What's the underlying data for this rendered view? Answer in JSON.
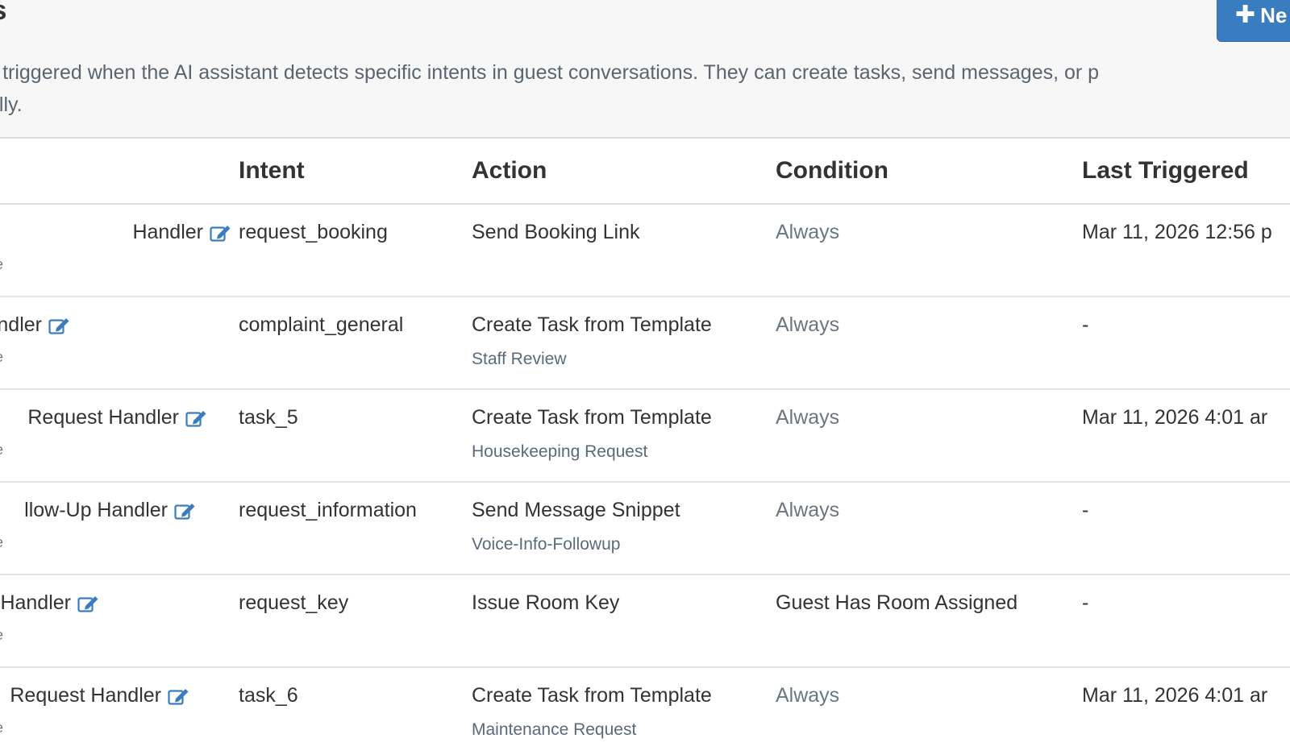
{
  "header": {
    "title": "ons",
    "new_button_label": "Ne",
    "description_line1": "are triggered when the AI assistant detects specific intents in guest conversations. They can create tasks, send messages, or p",
    "description_line2": "tically."
  },
  "table": {
    "columns": [
      "",
      "Intent",
      "Action",
      "Condition",
      "Last Triggered"
    ],
    "rows": [
      {
        "name": "Handler",
        "name_sub": "e",
        "intent": "request_booking",
        "action": "Send Booking Link",
        "action_sub": "",
        "condition": "Always",
        "last_triggered": "Mar 11, 2026 12:56 p"
      },
      {
        "name": "ndler",
        "name_sub": "e",
        "intent": "complaint_general",
        "action": "Create Task from Template",
        "action_sub": "Staff Review",
        "condition": "Always",
        "last_triggered": "-"
      },
      {
        "name": "Request Handler",
        "name_sub": "e",
        "intent": "task_5",
        "action": "Create Task from Template",
        "action_sub": "Housekeeping Request",
        "condition": "Always",
        "last_triggered": "Mar 11, 2026 4:01 ar"
      },
      {
        "name": "llow-Up Handler",
        "name_sub": "e",
        "intent": "request_information",
        "action": "Send Message Snippet",
        "action_sub": "Voice-Info-Followup",
        "condition": "Always",
        "last_triggered": "-"
      },
      {
        "name": "Handler",
        "name_sub": "e",
        "intent": "request_key",
        "action": "Issue Room Key",
        "action_sub": "",
        "condition": "Guest Has Room Assigned",
        "last_triggered": "-"
      },
      {
        "name": "Request Handler",
        "name_sub": "e",
        "intent": "task_6",
        "action": "Create Task from Template",
        "action_sub": "Maintenance Request",
        "condition": "Always",
        "last_triggered": "Mar 11, 2026 4:01 ar"
      }
    ]
  },
  "icons": {
    "edit": "edit-icon",
    "plus": "plus-icon"
  },
  "colors": {
    "accent": "#3a7cc0",
    "muted_text": "#6b7680",
    "sub_text": "#5a6a7a"
  }
}
